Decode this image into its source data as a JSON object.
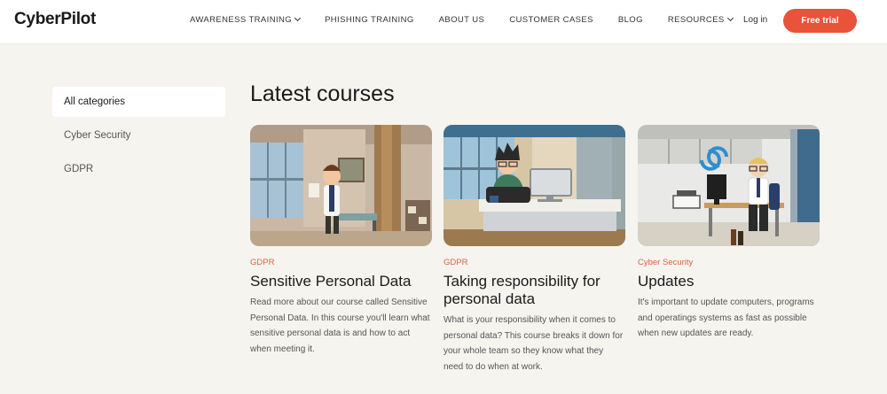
{
  "header": {
    "logo": "CyberPilot",
    "nav": [
      {
        "label": "AWARENESS TRAINING",
        "dropdown": true
      },
      {
        "label": "PHISHING TRAINING",
        "dropdown": false
      },
      {
        "label": "ABOUT US",
        "dropdown": false
      },
      {
        "label": "CUSTOMER CASES",
        "dropdown": false
      },
      {
        "label": "BLOG",
        "dropdown": false
      },
      {
        "label": "RESOURCES",
        "dropdown": true
      }
    ],
    "login": "Log in",
    "trial": "Free trial"
  },
  "sidebar": {
    "categories": [
      "All categories",
      "Cyber Security",
      "GDPR"
    ]
  },
  "main": {
    "title": "Latest courses",
    "courses": [
      {
        "tag": "GDPR",
        "title": "Sensitive Personal Data",
        "description": "Read more about our course called Sensitive Personal Data. In this course you'll learn what sensitive personal data is and how to act when meeting it."
      },
      {
        "tag": "GDPR",
        "title": "Taking responsibility for personal data",
        "description": "What is your responsibility when it comes to personal data? This course breaks it down for your whole team so they know what they need to do when at work."
      },
      {
        "tag": "Cyber Security",
        "title": "Updates",
        "description": "It's important to update computers, programs and operatings systems as fast as possible when new updates are ready."
      }
    ]
  },
  "colors": {
    "accent": "#e8533a",
    "tag": "#e0603f",
    "background": "#f6f4ef"
  }
}
